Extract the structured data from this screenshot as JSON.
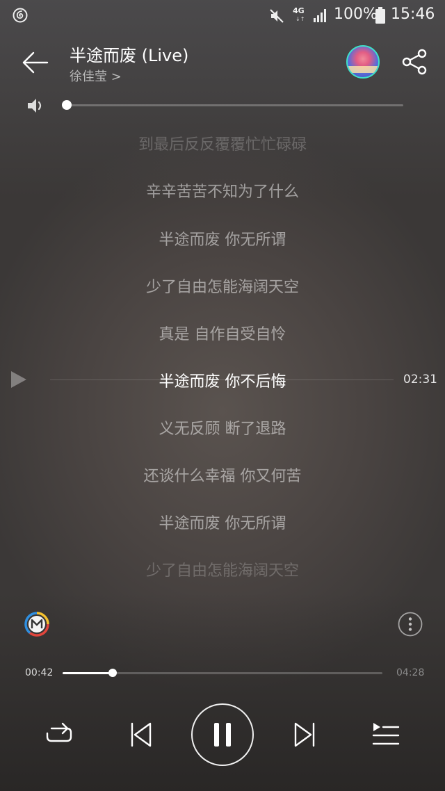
{
  "status_bar": {
    "network": "4G",
    "battery": "100%",
    "time": "15:46"
  },
  "header": {
    "title": "半途而废 (Live)",
    "artist": "徐佳莹 >"
  },
  "volume": {
    "level": 0.0
  },
  "lyrics": [
    {
      "text": "到最后反反覆覆忙忙碌碌",
      "state": "dim"
    },
    {
      "text": "辛辛苦苦不知为了什么",
      "state": "normal"
    },
    {
      "text": "半途而废 你无所谓",
      "state": "normal"
    },
    {
      "text": "少了自由怎能海阔天空",
      "state": "normal"
    },
    {
      "text": "真是 自作自受自怜",
      "state": "normal"
    },
    {
      "text": "半途而废 你不后悔",
      "state": "current"
    },
    {
      "text": "义无反顾 断了退路",
      "state": "normal"
    },
    {
      "text": "还谈什么幸福 你又何苦",
      "state": "normal"
    },
    {
      "text": "半途而废 你无所谓",
      "state": "normal"
    },
    {
      "text": "少了自由怎能海阔天空",
      "state": "dim"
    }
  ],
  "seek_time": "02:31",
  "progress": {
    "current": "00:42",
    "total": "04:28",
    "fraction": 0.157
  },
  "icons": [
    "netease-cloud-music-icon",
    "mute-icon",
    "signal-icon",
    "battery-icon",
    "back-arrow-icon",
    "album-art-avatar",
    "share-icon",
    "volume-icon",
    "play-triangle-icon",
    "m-logo-icon",
    "more-icon",
    "repeat-icon",
    "previous-icon",
    "pause-icon",
    "next-icon",
    "playlist-icon"
  ]
}
